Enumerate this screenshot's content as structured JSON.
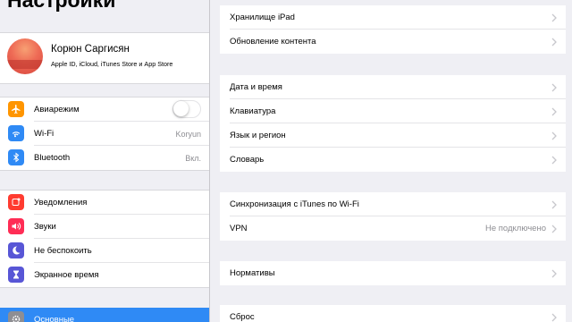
{
  "sidebar": {
    "title": "Настройки",
    "profile": {
      "name": "Корюн Саргисян",
      "subtitle": "Apple ID, iCloud, iTunes Store и App Store"
    },
    "connectivity": {
      "airplane": {
        "label": "Авиарежим",
        "icon": "airplane-icon",
        "icon_color": "#ff9500",
        "enabled": false
      },
      "wifi": {
        "label": "Wi-Fi",
        "value": "Koryun",
        "icon": "wifi-icon",
        "icon_color": "#2f8af5"
      },
      "bluetooth": {
        "label": "Bluetooth",
        "value": "Вкл.",
        "icon": "bluetooth-icon",
        "icon_color": "#2f8af5"
      }
    },
    "system": [
      {
        "label": "Уведомления",
        "icon": "notifications-icon",
        "icon_color": "#ff3b30"
      },
      {
        "label": "Звуки",
        "icon": "sounds-icon",
        "icon_color": "#ff2d55"
      },
      {
        "label": "Не беспокоить",
        "icon": "do-not-disturb-icon",
        "icon_color": "#5856d6"
      },
      {
        "label": "Экранное время",
        "icon": "screen-time-icon",
        "icon_color": "#5856d6"
      }
    ],
    "general": {
      "label": "Основные",
      "icon": "gear-icon",
      "icon_color": "#8e8e93",
      "selected": true
    }
  },
  "main": {
    "group1": [
      {
        "label": "Хранилище iPad"
      },
      {
        "label": "Обновление контента"
      }
    ],
    "group2": [
      {
        "label": "Дата и время"
      },
      {
        "label": "Клавиатура"
      },
      {
        "label": "Язык и регион"
      },
      {
        "label": "Словарь"
      }
    ],
    "group3": [
      {
        "label": "Синхронизация с iTunes по Wi-Fi"
      },
      {
        "label": "VPN",
        "value": "Не подключено"
      }
    ],
    "group4": [
      {
        "label": "Нормативы"
      }
    ],
    "group5": [
      {
        "label": "Сброс"
      }
    ]
  },
  "colors": {
    "accent": "#2f8af5",
    "background": "#efeff4",
    "secondary_text": "#8e8e93"
  }
}
